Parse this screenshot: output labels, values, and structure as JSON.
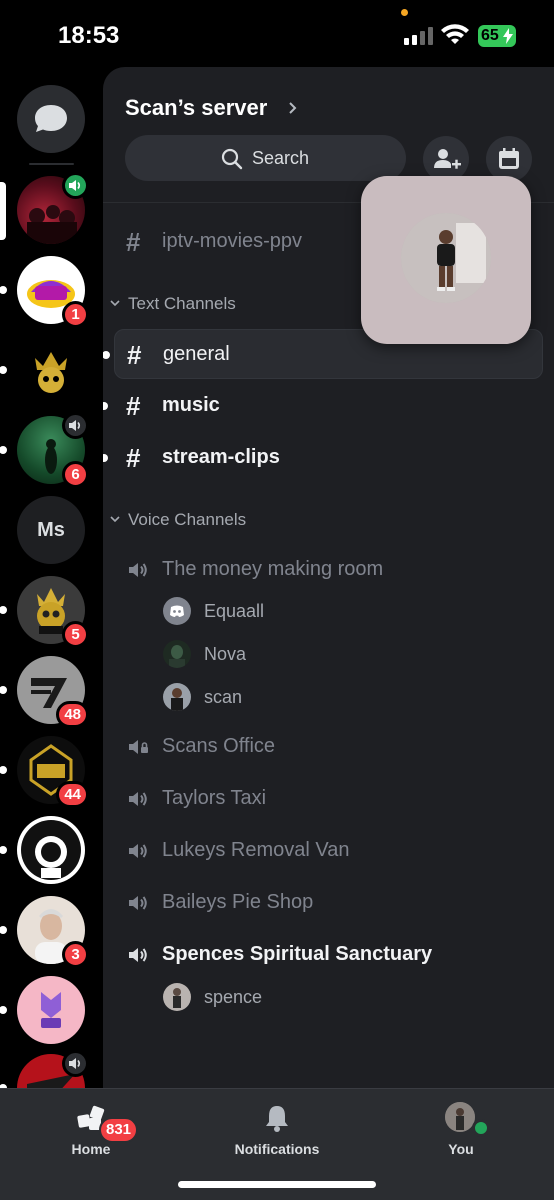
{
  "status_bar": {
    "time": "18:53",
    "battery": "65"
  },
  "servers": [
    {
      "badge": "",
      "voice": "active"
    },
    {
      "badge": "1",
      "voice": ""
    },
    {
      "badge": "",
      "voice": ""
    },
    {
      "badge": "6",
      "voice": "muted"
    },
    {
      "initials": "Ms"
    },
    {
      "badge": "5"
    },
    {
      "badge": "48"
    },
    {
      "badge": "44"
    },
    {
      "badge": ""
    },
    {
      "badge": "3"
    },
    {
      "badge": ""
    },
    {
      "badge": "",
      "voice": "muted"
    }
  ],
  "server": {
    "name": "Scan’s server"
  },
  "search": {
    "label": "Search"
  },
  "channels": {
    "top": {
      "name": "iptv-movies-ppv"
    },
    "text_category": "Text Channels",
    "text": [
      {
        "name": "general"
      },
      {
        "name": "music"
      },
      {
        "name": "stream-clips"
      }
    ],
    "voice_category": "Voice Channels",
    "voice": [
      {
        "name": "The money making room",
        "users": [
          "Equaall",
          "Nova",
          "scan"
        ]
      },
      {
        "name": "Scans Office"
      },
      {
        "name": "Taylors Taxi"
      },
      {
        "name": "Lukeys Removal Van"
      },
      {
        "name": "Baileys Pie Shop"
      },
      {
        "name": "Spences Spiritual Sanctuary",
        "users": [
          "spence"
        ]
      }
    ]
  },
  "tabbar": {
    "home": "Home",
    "home_badge": "831",
    "notifications": "Notifications",
    "you": "You"
  },
  "colors": {
    "accent_red": "#f23f43",
    "online_green": "#23a55a",
    "panel_bg": "#1e1f23",
    "rail_bg": "#000000"
  }
}
